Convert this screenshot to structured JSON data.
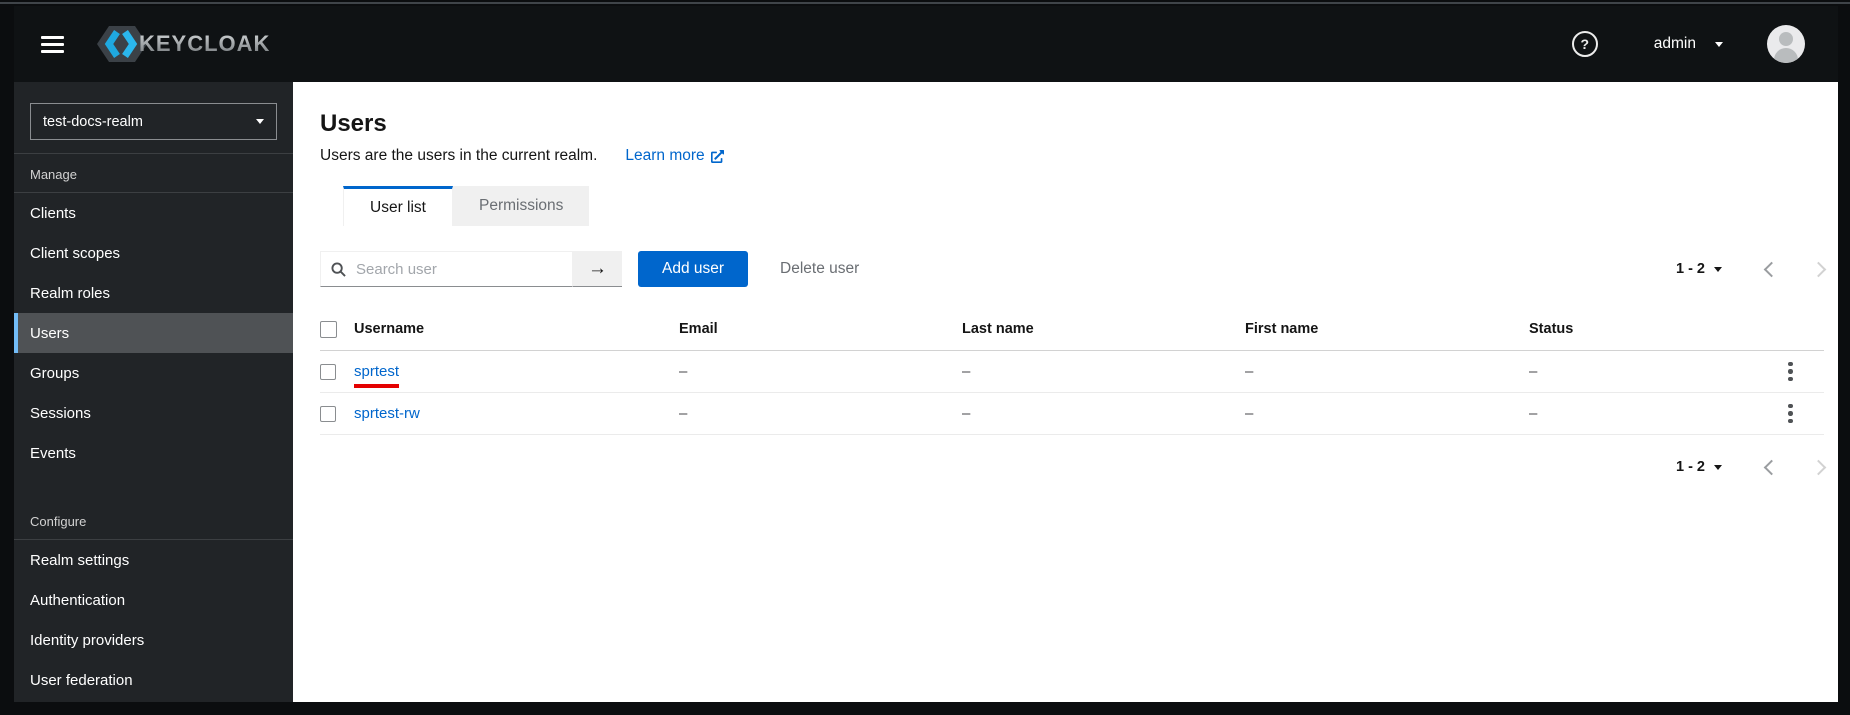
{
  "topbar": {
    "brand": "KEYCLOAK",
    "user": "admin"
  },
  "sidebar": {
    "realm": "test-docs-realm",
    "sections": [
      {
        "label": "Manage",
        "items": [
          {
            "label": "Clients",
            "selected": false
          },
          {
            "label": "Client scopes",
            "selected": false
          },
          {
            "label": "Realm roles",
            "selected": false
          },
          {
            "label": "Users",
            "selected": true
          },
          {
            "label": "Groups",
            "selected": false
          },
          {
            "label": "Sessions",
            "selected": false
          },
          {
            "label": "Events",
            "selected": false
          }
        ]
      },
      {
        "label": "Configure",
        "items": [
          {
            "label": "Realm settings",
            "selected": false
          },
          {
            "label": "Authentication",
            "selected": false
          },
          {
            "label": "Identity providers",
            "selected": false
          },
          {
            "label": "User federation",
            "selected": false
          }
        ]
      }
    ]
  },
  "main": {
    "title": "Users",
    "description": "Users are the users in the current realm.",
    "learn_more": "Learn more",
    "tabs": [
      {
        "label": "User list",
        "active": true
      },
      {
        "label": "Permissions",
        "active": false
      }
    ],
    "toolbar": {
      "search_placeholder": "Search user",
      "add_user": "Add user",
      "delete_user": "Delete user",
      "pagination_label": "1 - 2"
    },
    "table": {
      "columns": [
        "Username",
        "Email",
        "Last name",
        "First name",
        "Status"
      ],
      "rows": [
        {
          "username": "sprtest",
          "email": "–",
          "last_name": "–",
          "first_name": "–",
          "status": "–",
          "annotated": true
        },
        {
          "username": "sprtest-rw",
          "email": "–",
          "last_name": "–",
          "first_name": "–",
          "status": "–",
          "annotated": false
        }
      ]
    }
  },
  "colors": {
    "accent_blue": "#0066cc",
    "nav_selected_bar": "#73bcf7",
    "annotation_red": "#e40000",
    "topbar_bg": "#0f1214",
    "sidebar_bg": "#212427"
  }
}
